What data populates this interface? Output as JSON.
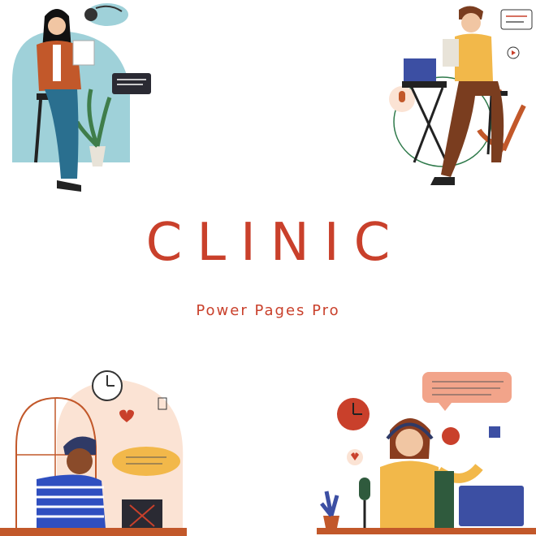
{
  "brand": {
    "title": "CLINIC",
    "subtitle": "Power Pages Pro",
    "accent_color": "#c9402b"
  },
  "illustrations": [
    {
      "icon": "woman-reading-podcast-icon"
    },
    {
      "icon": "man-podcasting-microphone-icon"
    },
    {
      "icon": "man-at-laptop-icon"
    },
    {
      "icon": "woman-podcasting-laptop-icon"
    }
  ]
}
